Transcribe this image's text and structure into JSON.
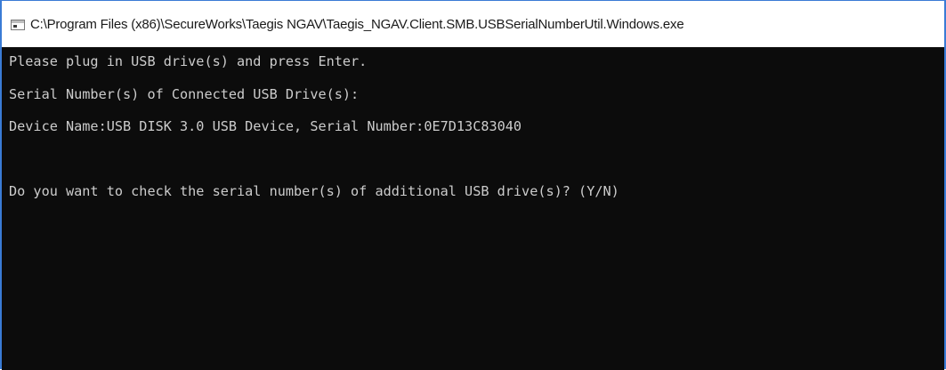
{
  "window": {
    "title": "C:\\Program Files (x86)\\SecureWorks\\Taegis NGAV\\Taegis_NGAV.Client.SMB.USBSerialNumberUtil.Windows.exe"
  },
  "console": {
    "lines": [
      "Please plug in USB drive(s) and press Enter.",
      "Serial Number(s) of Connected USB Drive(s):",
      "Device Name:USB DISK 3.0 USB Device, Serial Number:0E7D13C83040",
      "",
      "Do you want to check the serial number(s) of additional USB drive(s)? (Y/N)"
    ],
    "colors": {
      "background": "#0c0c0c",
      "foreground": "#cccccc"
    }
  }
}
